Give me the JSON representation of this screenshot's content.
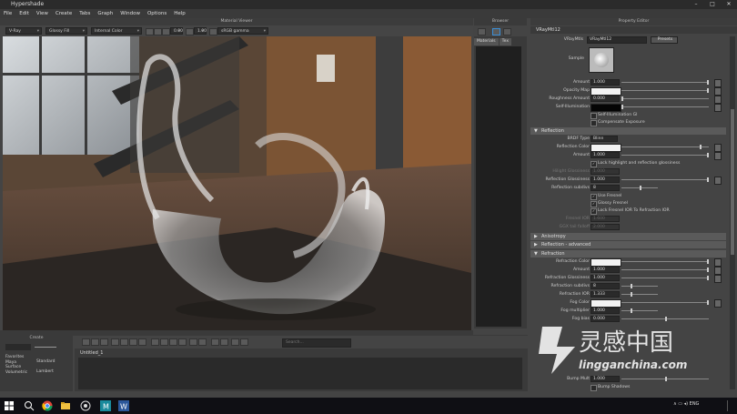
{
  "window": {
    "title": "Hypershade",
    "controls": [
      "–",
      "□",
      "✕"
    ]
  },
  "menu": [
    "File",
    "Edit",
    "View",
    "Create",
    "Tabs",
    "Graph",
    "Window",
    "Options",
    "Help"
  ],
  "viewer": {
    "header": "Material Viewer",
    "renderer": "V-Ray",
    "shading": "Glossy Fill",
    "scene": "Internal Color",
    "value_a": "0.00",
    "value_b": "1.00",
    "colorspace": "sRGB gamma"
  },
  "browser": {
    "header": "Browser",
    "tabs": [
      "Materials",
      "Tex"
    ]
  },
  "property_editor": {
    "header": "Property Editor",
    "tab": "VRayMtl12",
    "mtl_label": "VRayMtls",
    "mtl_value": "VRayMtl12",
    "presets_button": "Presets",
    "sample_label": "Sample",
    "diffuse_rows": [
      {
        "label": "Amount",
        "value": "1.000"
      },
      {
        "label": "Opacity Map",
        "value": ""
      },
      {
        "label": "Roughness Amount",
        "value": "0.000"
      },
      {
        "label": "Self-Illumination",
        "value": ""
      }
    ],
    "diffuse_checks": [
      "Self-Illumination GI",
      "Compensate Exposure"
    ],
    "sections": {
      "reflection": "Reflection",
      "anisotropy": "Anisotropy",
      "reflection_advanced": "Reflection - advanced",
      "refraction": "Refraction"
    },
    "reflection_rows": [
      {
        "label": "BRDF Type",
        "value": "Blinn"
      },
      {
        "label": "Reflection Color",
        "value": ""
      },
      {
        "label": "Amount",
        "value": "1.000"
      }
    ],
    "lock_highlight": "Lock highlight and reflection glossiness",
    "reflection_rows2": [
      {
        "label": "Hilight Glossiness",
        "value": "1.000"
      },
      {
        "label": "Reflection Glossiness",
        "value": "1.000"
      },
      {
        "label": "Reflection subdivs",
        "value": "8"
      }
    ],
    "fresnel_checks": [
      "Use Fresnel",
      "Glossy Fresnel",
      "Lock Fresnel IOR To Refraction IOR"
    ],
    "fresnel_rows": [
      {
        "label": "Fresnel IOR",
        "value": "1.600"
      },
      {
        "label": "GGX tail falloff",
        "value": "2.000"
      }
    ],
    "refraction_rows": [
      {
        "label": "Refraction Color",
        "value": ""
      },
      {
        "label": "Amount",
        "value": "1.000"
      },
      {
        "label": "Refraction Glossiness",
        "value": "1.000"
      },
      {
        "label": "Refraction subdivs",
        "value": "8"
      },
      {
        "label": "Refraction IOR",
        "value": "1.333"
      },
      {
        "label": "Fog Color",
        "value": ""
      },
      {
        "label": "Fog multiplier",
        "value": "1.000"
      },
      {
        "label": "Fog bias",
        "value": "0.000"
      }
    ],
    "bottom_rows": [
      {
        "label": "Bump Mult",
        "value": "1.000"
      }
    ],
    "bump_shadows": "Bump Shadows"
  },
  "create_panel": {
    "header": "Create",
    "items": [
      "Favorites",
      "Maya",
      "Surface",
      "Volumetric"
    ],
    "swatches": [
      "Standard",
      "Lambert"
    ]
  },
  "work_area": {
    "tab": "Untitled_1",
    "search_placeholder": "Search..."
  },
  "taskbar": {
    "lang": "ENG",
    "time": "",
    "date": ""
  },
  "watermark": {
    "text": "灵感中国",
    "url": "lingganchina.com"
  }
}
